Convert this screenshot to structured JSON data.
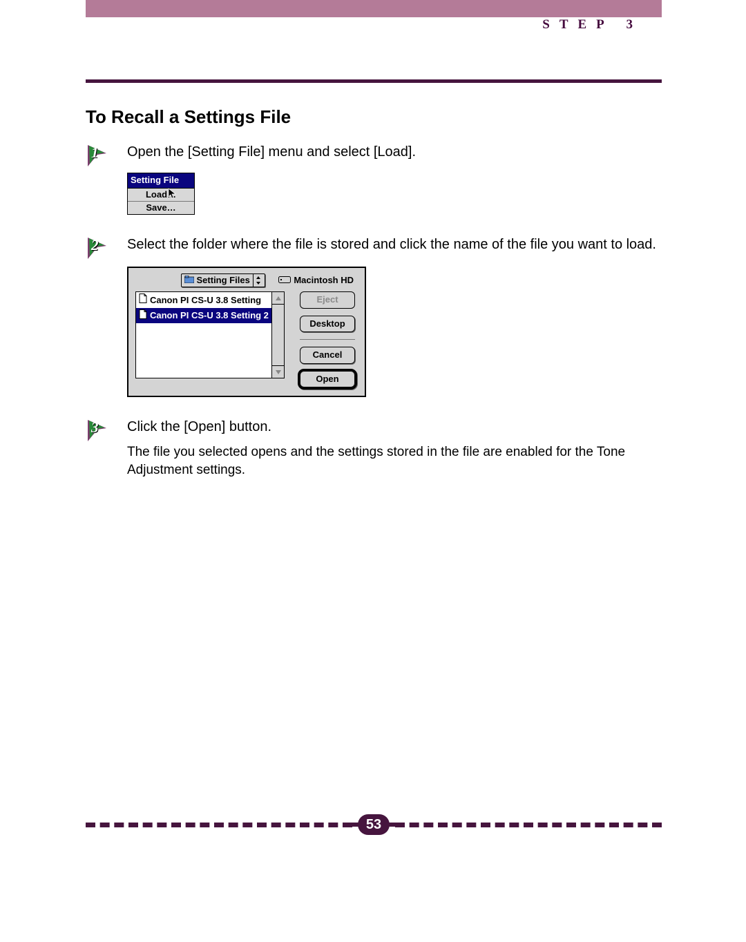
{
  "header": {
    "step_label": "STEP  3"
  },
  "section": {
    "title": "To Recall a Settings File"
  },
  "steps": [
    {
      "num": "1",
      "lead": "Open the [Setting File] menu and select [Load].",
      "menu": {
        "title": "Setting File",
        "items": [
          "Load…",
          "Save…"
        ]
      }
    },
    {
      "num": "2",
      "lead": "Select the folder where the file is stored and click the name of the file you want to load.",
      "dialog": {
        "folder": "Setting Files",
        "disk": "Macintosh HD",
        "files": [
          {
            "name": "Canon PI CS-U 3.8 Setting",
            "selected": false
          },
          {
            "name": "Canon PI CS-U 3.8 Setting 2",
            "selected": true
          }
        ],
        "buttons": {
          "eject": "Eject",
          "desktop": "Desktop",
          "cancel": "Cancel",
          "open": "Open"
        }
      }
    },
    {
      "num": "3",
      "lead": "Click the [Open] button.",
      "note": "The file you selected opens and the settings stored in the file are enabled for the Tone Adjustment settings."
    }
  ],
  "footer": {
    "page": "53"
  }
}
